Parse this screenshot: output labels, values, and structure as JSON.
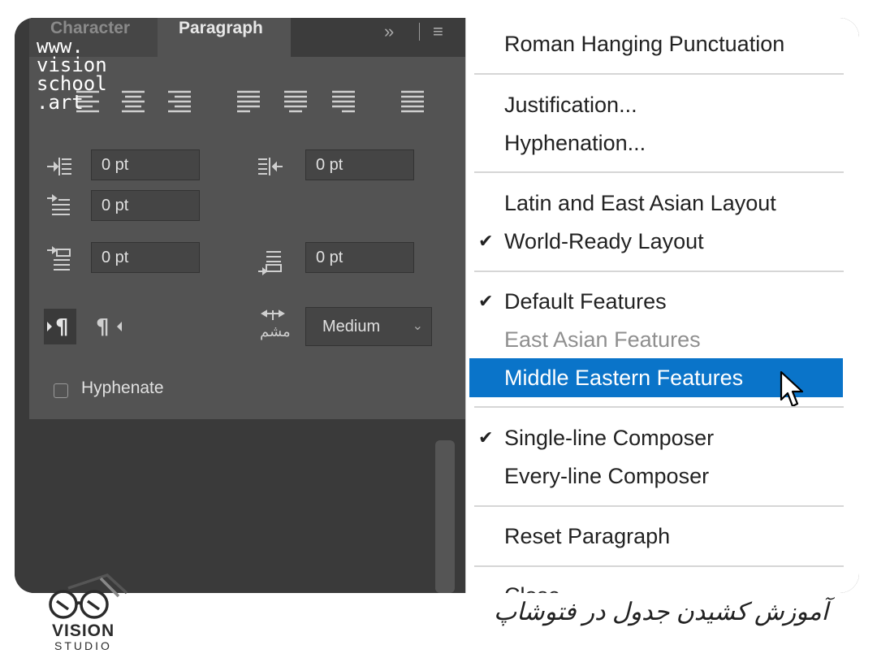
{
  "panel": {
    "tabs": {
      "character": "Character",
      "paragraph": "Paragraph"
    },
    "more_glyph": "»",
    "menu_glyph": "≡",
    "fields": {
      "left_indent": "0 pt",
      "right_indent": "0 pt",
      "first_line_indent": "0 pt",
      "space_before": "0 pt",
      "space_after": "0 pt"
    },
    "direction_ltr": "¶",
    "direction_rtl": "¶",
    "kashida_dropdown": "Medium",
    "hyphenate_label": "Hyphenate"
  },
  "watermark": "www.\nvision\nschool\n.art",
  "menu": {
    "items": [
      {
        "label": "Roman Hanging Punctuation"
      },
      {
        "label": "Justification..."
      },
      {
        "label": "Hyphenation..."
      },
      {
        "label": "Latin and East Asian Layout"
      },
      {
        "label": "World-Ready Layout",
        "checked": true
      },
      {
        "label": "Default Features",
        "checked": true
      },
      {
        "label": "East Asian Features",
        "disabled": true
      },
      {
        "label": "Middle Eastern Features",
        "highlighted": true
      },
      {
        "label": "Single-line Composer",
        "checked": true
      },
      {
        "label": "Every-line Composer"
      },
      {
        "label": "Reset Paragraph"
      },
      {
        "label": "Close"
      }
    ],
    "check_glyph": "✔"
  },
  "footer": {
    "logo_text": "VISION",
    "logo_sub": "STUDIO",
    "caption": "آموزش کشیدن جدول در فتوشاپ"
  },
  "colors": {
    "accent": "#0a74c9",
    "panel": "#535353"
  }
}
